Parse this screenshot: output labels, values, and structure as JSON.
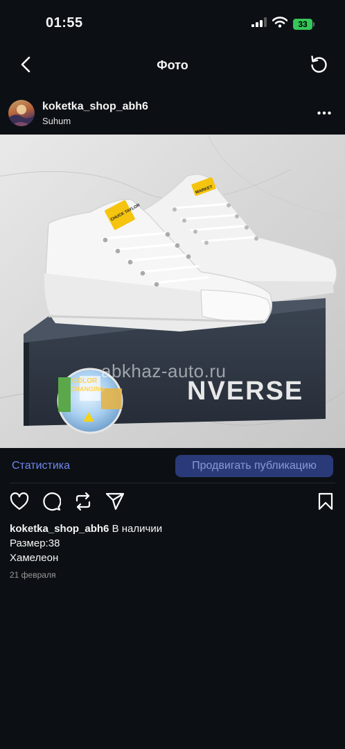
{
  "status_bar": {
    "time": "01:55",
    "battery": "33"
  },
  "nav": {
    "title": "Фото"
  },
  "post": {
    "username": "koketka_shop_abh6",
    "location": "Suhum",
    "image": {
      "box_label": "NVERSE",
      "tag_text_1": "CHUCK TAYLOR",
      "tag_text_2": "MARKET",
      "sticker_text_1": "COLOR",
      "sticker_text_2": "CHANGING",
      "watermark": "abkhaz-auto.ru"
    },
    "stats_label": "Статистика",
    "promote_label": "Продвигать публикацию",
    "caption": {
      "username": "koketka_shop_abh6",
      "line1_text": "В наличии",
      "line2": "Размер:38",
      "line3": "Хамелеон"
    },
    "date": "21 февраля"
  },
  "colors": {
    "background": "#0c1014",
    "link": "#6f87f0",
    "promote_bg": "#2a3a78",
    "battery": "#34c759"
  }
}
